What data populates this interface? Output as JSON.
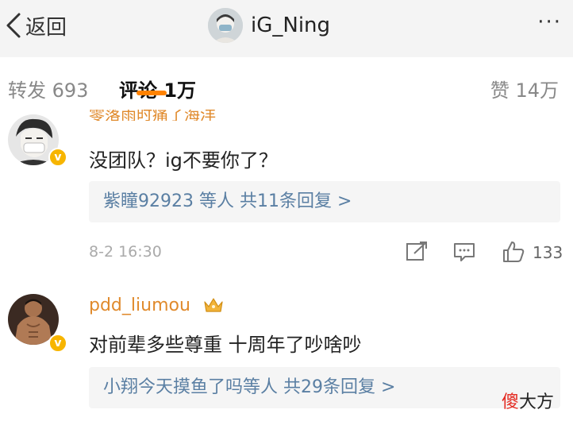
{
  "header": {
    "back_label": "返回",
    "title": "iG_Ning",
    "more_label": "···"
  },
  "tabs": {
    "repost": "转发 693",
    "comments": "评论 1万",
    "likes": "赞 14万"
  },
  "comments": [
    {
      "username_partial": "零落雨时痛了海洋",
      "text": "没团队？ig不要你了？",
      "reply_summary": "紫瞳92923 等人  共11条回复 >",
      "time": "8-2 16:30",
      "likes": "133"
    },
    {
      "username": "pdd_liumou",
      "text": "对前辈多些尊重 十周年了吵啥吵",
      "reply_summary": "小翔今天摸鱼了吗等人  共29条回复 >"
    }
  ],
  "badge_letter": "v",
  "watermark": {
    "first": "傻",
    "rest": "大方"
  },
  "colors": {
    "accent": "#ff8200",
    "username": "#e08a2c",
    "link": "#5a7fa3",
    "verified": "#f7b500"
  }
}
